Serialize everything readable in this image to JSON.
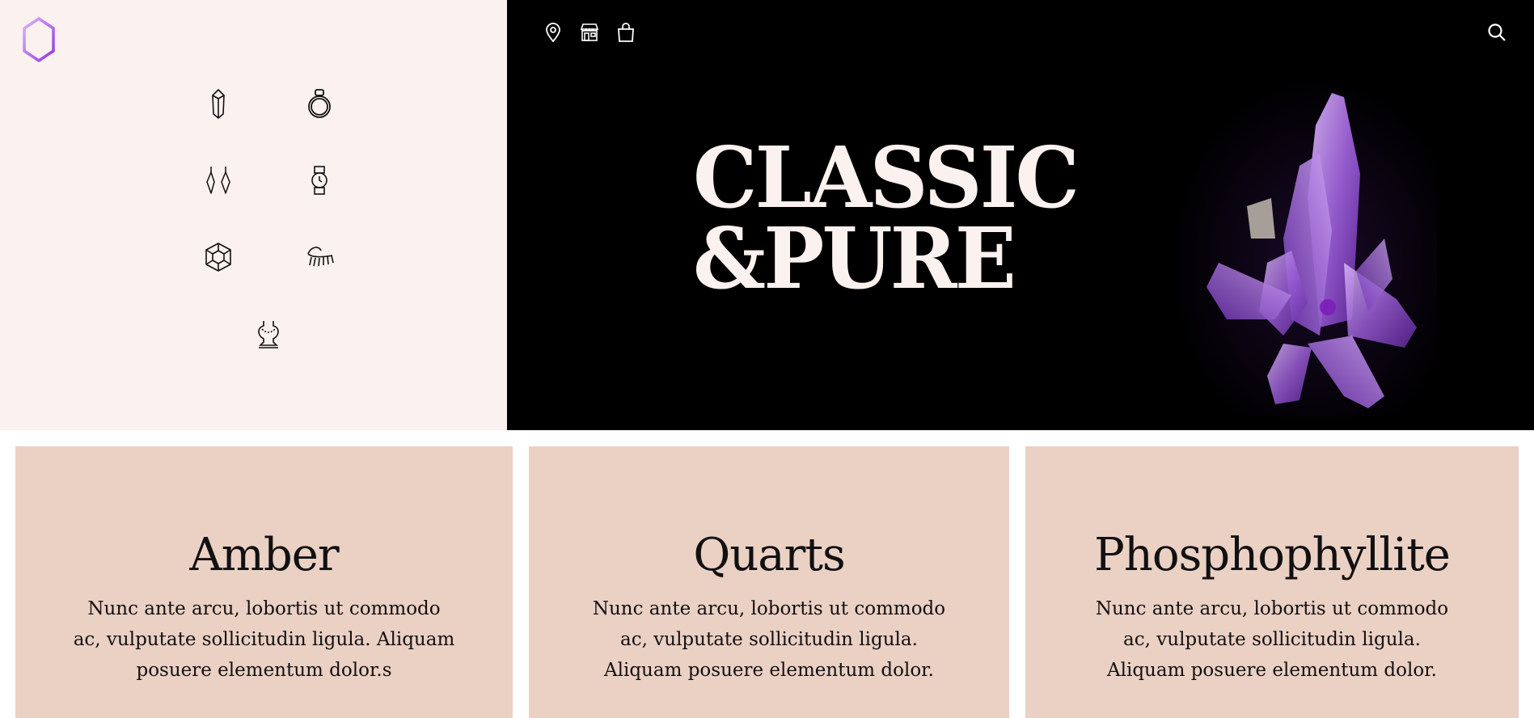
{
  "brand": {
    "logo_icon": "hexagon-logo-icon",
    "accent": "#a855f7"
  },
  "colors": {
    "panel_bg": "#fbf1ee",
    "hero_bg": "#000000",
    "card_bg": "#ebd0c4",
    "crystal": "#a970e0"
  },
  "categories": [
    {
      "icon": "crystal-icon"
    },
    {
      "icon": "ring-icon"
    },
    {
      "icon": "earrings-icon"
    },
    {
      "icon": "watch-icon"
    },
    {
      "icon": "gem-icon"
    },
    {
      "icon": "hair-clip-icon"
    },
    {
      "icon": "necklace-bust-icon"
    }
  ],
  "header": {
    "icons": [
      "location-pin-icon",
      "store-icon",
      "shopping-bag-icon",
      "search-icon"
    ]
  },
  "hero": {
    "title": "CLASSIC\n&PURE",
    "image": "amethyst-crystal-image"
  },
  "cards": [
    {
      "title": "Amber",
      "text": "Nunc ante arcu, lobortis ut commodo ac, vulputate sollicitudin ligula. Aliquam posuere elementum dolor.s"
    },
    {
      "title": "Quarts",
      "text": "Nunc ante arcu, lobortis ut commodo ac, vulputate sollicitudin ligula. Aliquam posuere elementum dolor."
    },
    {
      "title": "Phosphophyllite",
      "text": "Nunc ante arcu, lobortis ut commodo ac, vulputate sollicitudin ligula. Aliquam posuere elementum dolor."
    }
  ]
}
